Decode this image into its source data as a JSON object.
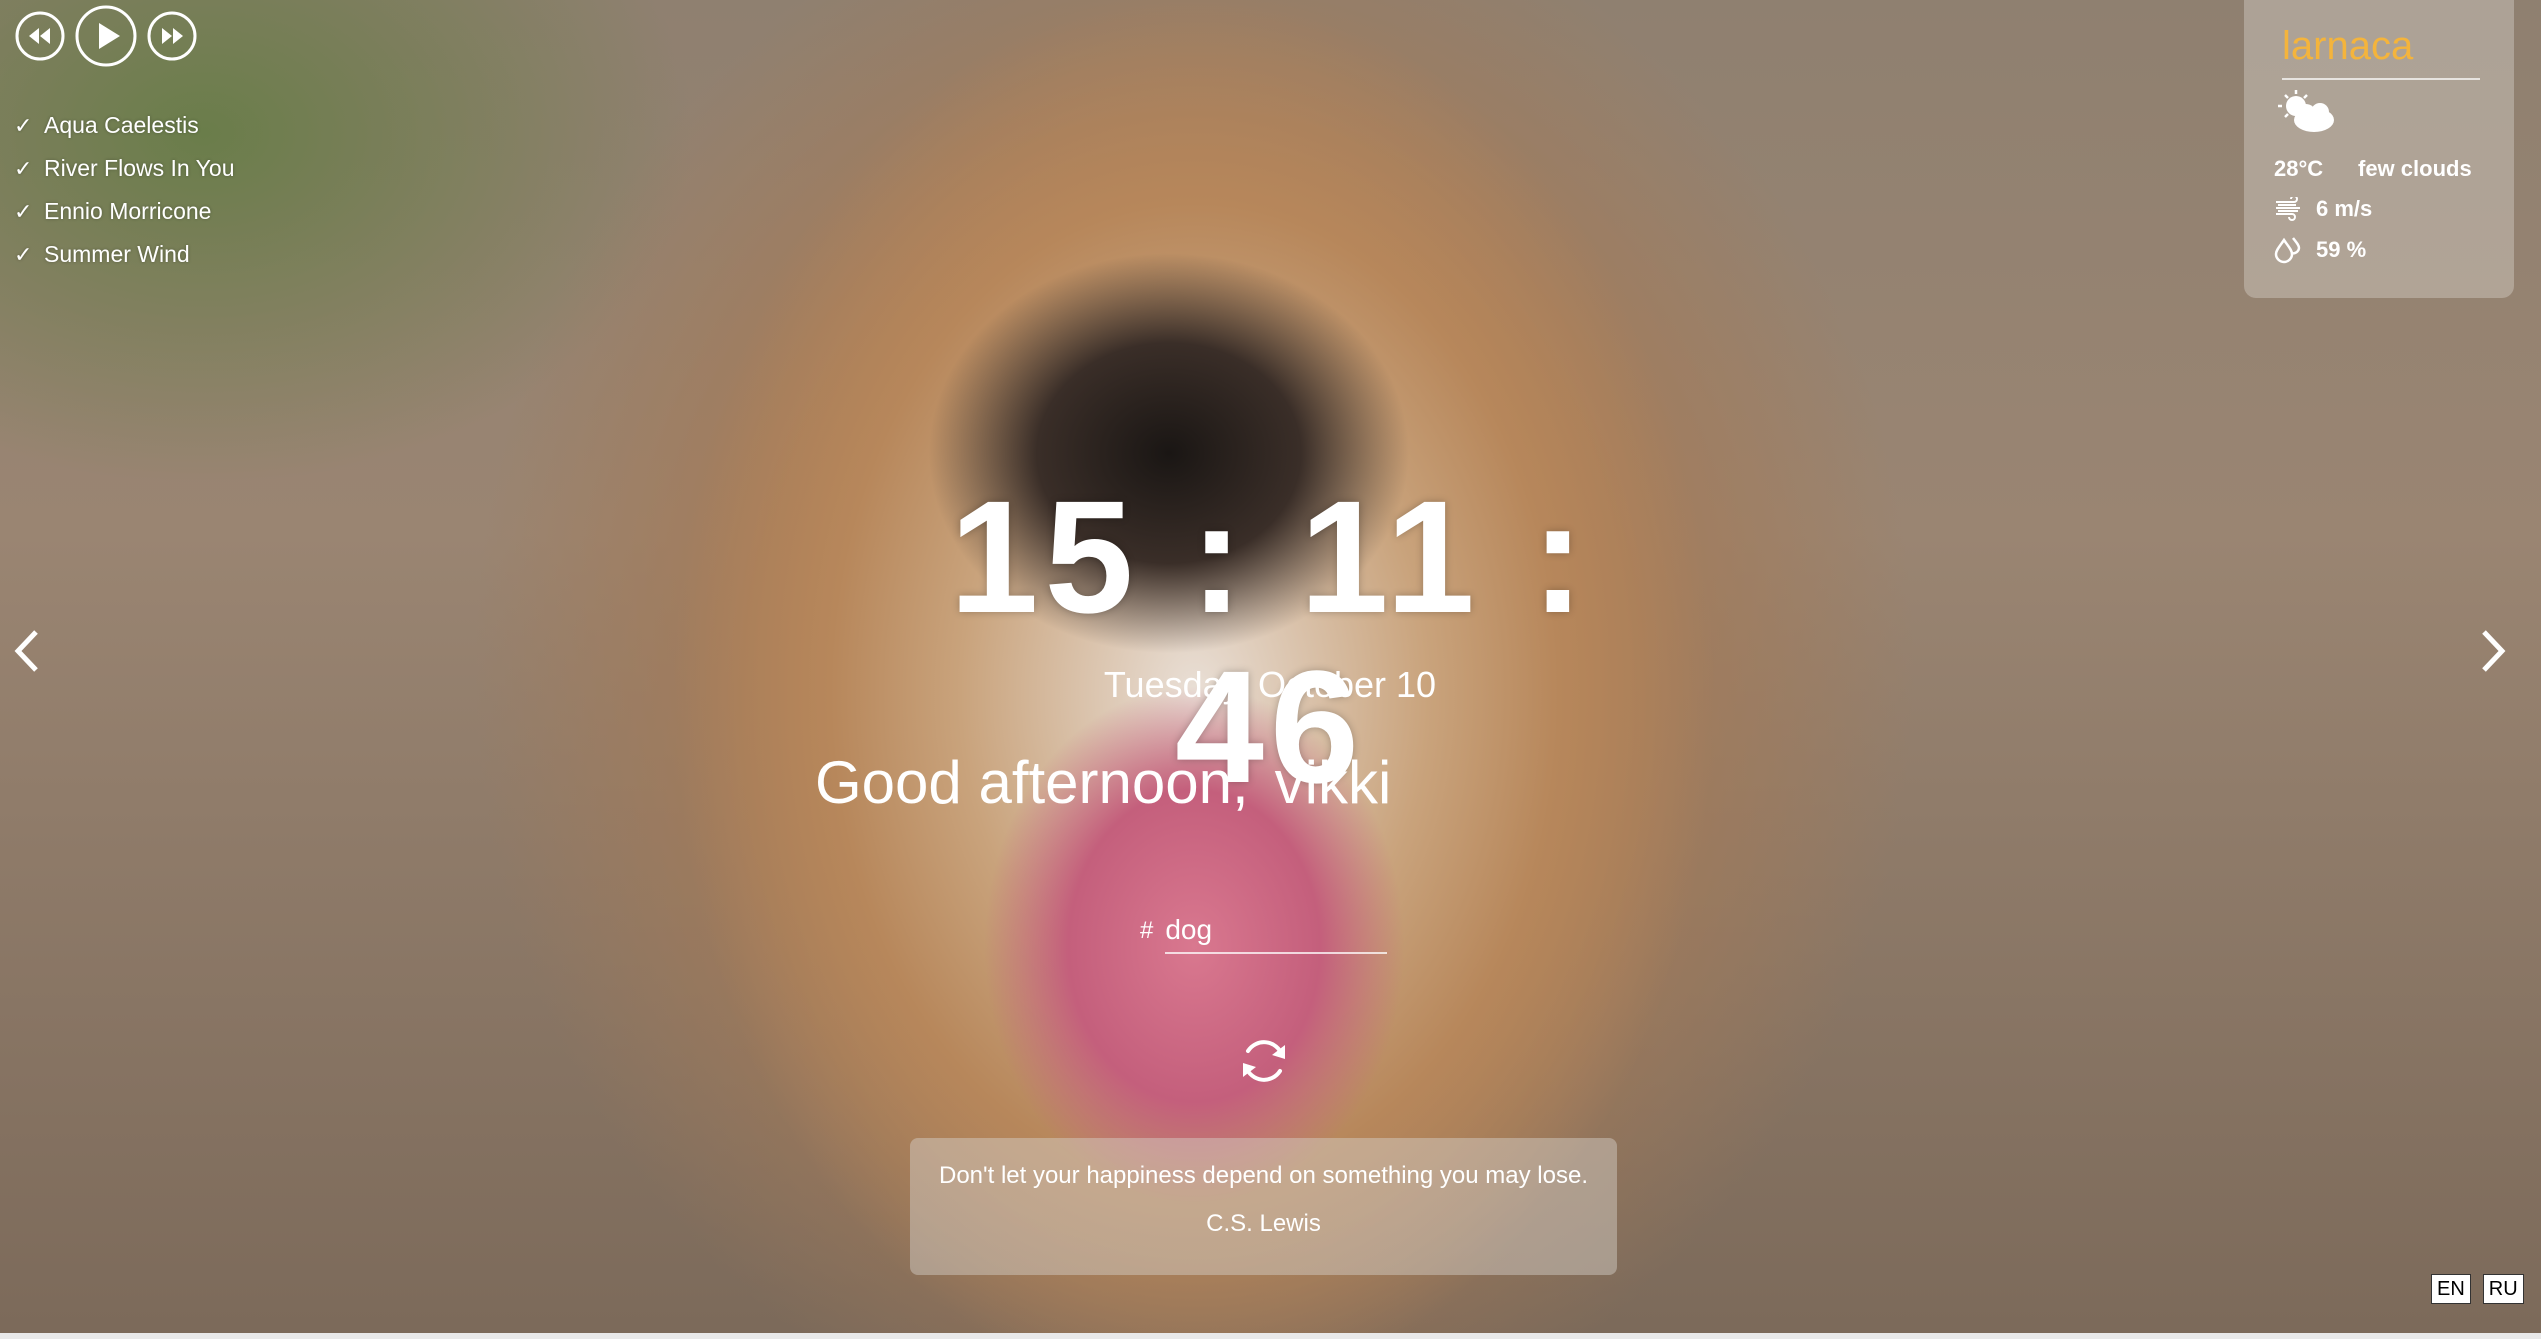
{
  "player": {
    "prev_icon": "rewind-icon",
    "play_icon": "play-icon",
    "next_icon": "fast-forward-icon"
  },
  "playlist": [
    {
      "check": "✓",
      "title": "Aqua Caelestis"
    },
    {
      "check": "✓",
      "title": "River Flows In You"
    },
    {
      "check": "✓",
      "title": "Ennio Morricone"
    },
    {
      "check": "✓",
      "title": "Summer Wind"
    }
  ],
  "weather": {
    "city": "larnaca",
    "icon": "partly-cloudy-icon",
    "temperature": "28°C",
    "description": "few clouds",
    "wind": "6 m/s",
    "humidity": "59 %",
    "city_color": "#f4b43c"
  },
  "clock": {
    "time": "15 : 11 : 46",
    "date": "Tuesday, October 10"
  },
  "greeting": {
    "text": "Good afternoon,",
    "name": "vikki"
  },
  "search": {
    "prefix": "#",
    "value": "dog"
  },
  "quote": {
    "text": "Don't let your happiness depend on something you may lose.",
    "author": "C.S. Lewis"
  },
  "navigation": {
    "prev_icon": "chevron-left-icon",
    "next_icon": "chevron-right-icon"
  },
  "language": {
    "options": [
      "EN",
      "RU"
    ]
  }
}
